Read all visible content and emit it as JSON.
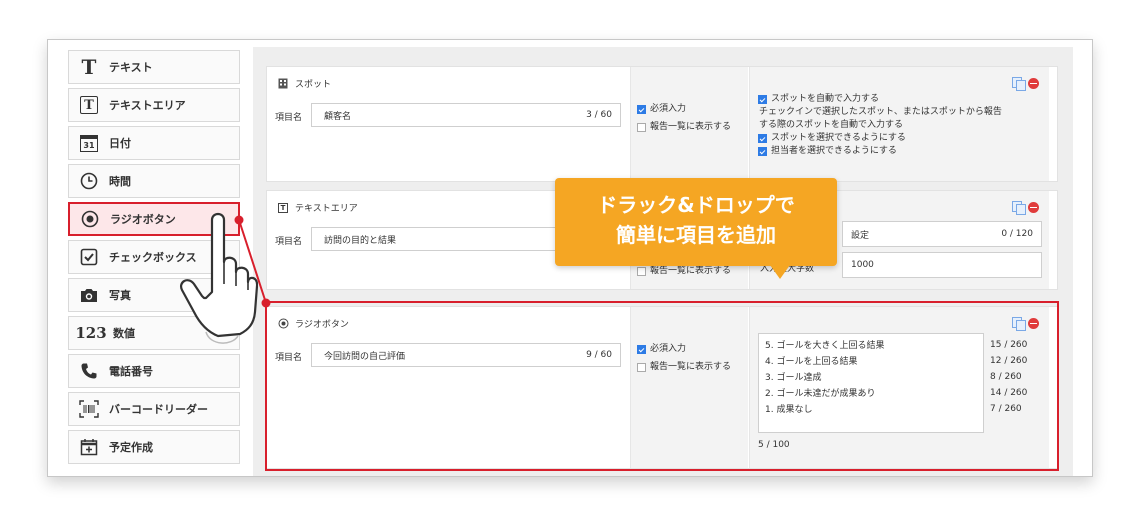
{
  "sidebar": {
    "items": [
      {
        "label": "テキスト",
        "icon": "serif-t-icon"
      },
      {
        "label": "テキストエリア",
        "icon": "boxed-t-icon"
      },
      {
        "label": "日付",
        "icon": "calendar-31-icon"
      },
      {
        "label": "時間",
        "icon": "clock-icon"
      },
      {
        "label": "ラジオボタン",
        "icon": "radio-icon"
      },
      {
        "label": "チェックボックス",
        "icon": "checkbox-icon"
      },
      {
        "label": "写真",
        "icon": "camera-icon"
      },
      {
        "label": "数値",
        "icon": "numeric-123-icon"
      },
      {
        "label": "電話番号",
        "icon": "phone-icon"
      },
      {
        "label": "バーコードリーダー",
        "icon": "barcode-icon"
      },
      {
        "label": "予定作成",
        "icon": "calendar-plus-icon"
      }
    ],
    "numeric_icon_text": "123",
    "calendar_icon_text": "31"
  },
  "cards": {
    "spot": {
      "title": "スポット",
      "name_label": "項目名",
      "name_value": "顧客名",
      "name_count": "3 / 60",
      "required_label": "必須入力",
      "show_in_list_label": "報告一覧に表示する",
      "options": [
        {
          "checked": true,
          "text": "スポットを自動で入力する"
        },
        {
          "checked": false,
          "text": "チェックインで選択したスポット、またはスポットから報告"
        },
        {
          "checked": false,
          "text": "する際のスポットを自動で入力する"
        },
        {
          "checked": true,
          "text": "スポットを選択できるようにする"
        },
        {
          "checked": true,
          "text": "担当者を選択できるようにする"
        }
      ]
    },
    "textarea": {
      "title": "テキストエリア",
      "name_label": "項目名",
      "name_value": "訪問の目的と結果",
      "show_in_list_label": "報告一覧に表示する",
      "setting_text": "設定",
      "setting_count": "0 / 120",
      "max_chars_label": "入力最大字数",
      "max_chars_value": "1000"
    },
    "radio": {
      "title": "ラジオボタン",
      "name_label": "項目名",
      "name_value": "今回訪問の自己評価",
      "name_count": "9 / 60",
      "required_label": "必須入力",
      "show_in_list_label": "報告一覧に表示する",
      "choices": [
        {
          "text": "5. ゴールを大きく上回る結果",
          "count": "15 / 260"
        },
        {
          "text": "4. ゴールを上回る結果",
          "count": "12 / 260"
        },
        {
          "text": "3. ゴール達成",
          "count": "8 / 260"
        },
        {
          "text": "2. ゴール未達だが成果あり",
          "count": "14 / 260"
        },
        {
          "text": "1. 成果なし",
          "count": "7 / 260"
        }
      ],
      "choices_count": "5 / 100"
    }
  },
  "callout": {
    "line1": "ドラック&ドロップで",
    "line2": "簡単に項目を追加"
  },
  "colors": {
    "accent_red": "#d81f2c",
    "callout_orange": "#f5a623",
    "checkbox_blue": "#2d7be5"
  }
}
